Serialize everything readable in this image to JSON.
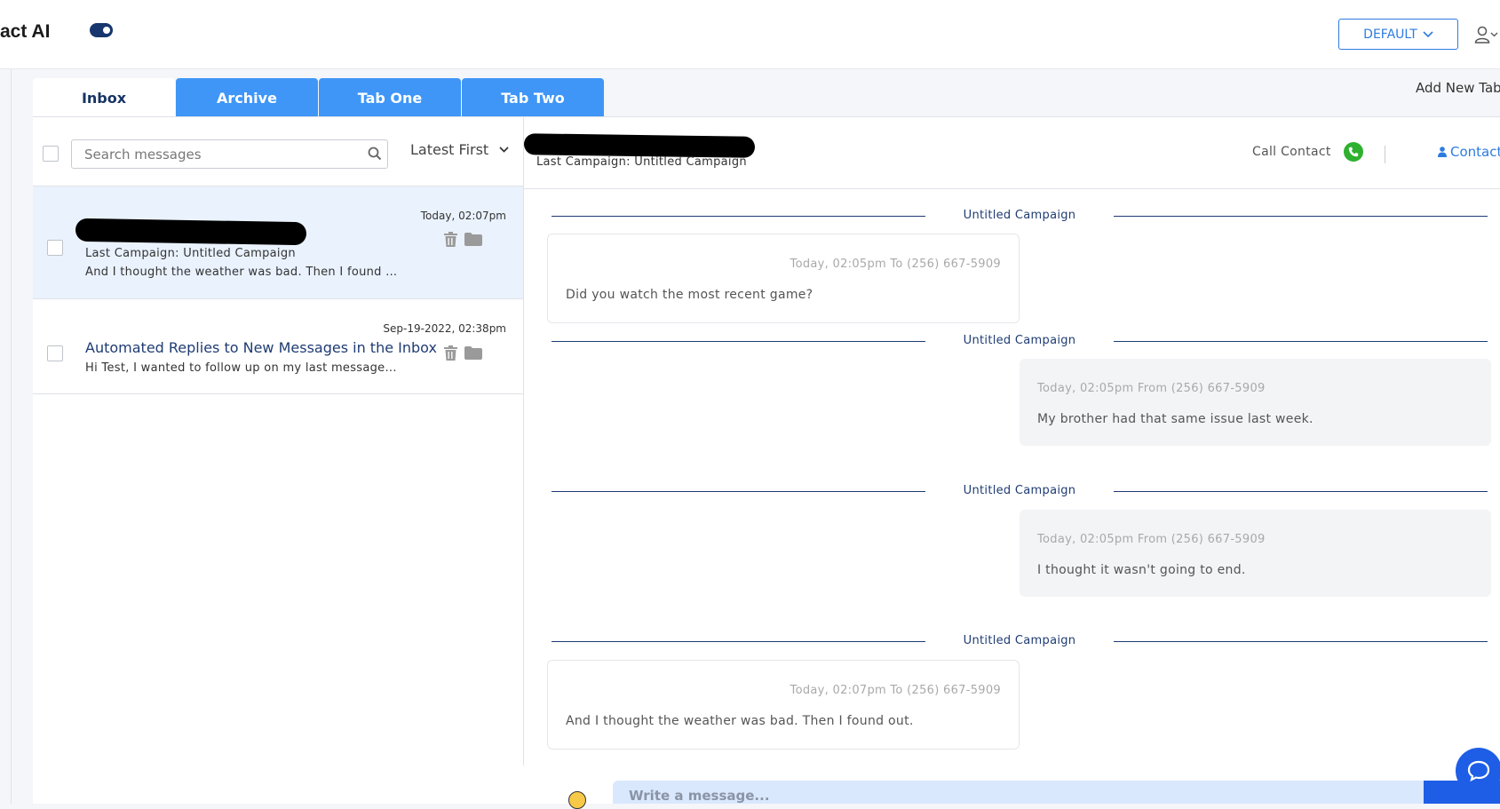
{
  "app": {
    "brand": "act AI"
  },
  "header": {
    "profile_label": "DEFAULT",
    "toggle_on": true
  },
  "tabs": [
    {
      "label": "Inbox",
      "active": true
    },
    {
      "label": "Archive",
      "active": false
    },
    {
      "label": "Tab One",
      "active": false
    },
    {
      "label": "Tab Two",
      "active": false
    }
  ],
  "add_tab_label": "Add New Tab",
  "list": {
    "search_placeholder": "Search messages",
    "sort_label": "Latest First",
    "conversations": [
      {
        "name_redacted": true,
        "time": "Today, 02:07pm",
        "campaign": "Last Campaign: Untitled Campaign",
        "snippet": "And I thought the weather was bad. Then I found out.",
        "selected": true
      },
      {
        "title": "Automated Replies to New Messages in the Inbox",
        "time": "Sep-19-2022, 02:38pm",
        "snippet": "Hi Test, I wanted to follow up on my last message..."
      }
    ]
  },
  "chat": {
    "name_redacted": true,
    "last_campaign": "Last Campaign: Untitled Campaign",
    "call_label": "Call Contact",
    "contact_info_label": "Contact Info",
    "separator_label": "Untitled Campaign",
    "messages": [
      {
        "direction": "out",
        "meta": "Today, 02:05pm To (256) 667-5909",
        "text": "Did you watch the most recent game?"
      },
      {
        "direction": "in",
        "meta": "Today, 02:05pm From (256) 667-5909",
        "text": "My brother had that same issue last week."
      },
      {
        "direction": "in",
        "meta": "Today, 02:05pm From (256) 667-5909",
        "text": "I thought it wasn't going to end."
      },
      {
        "direction": "out",
        "meta": "Today, 02:07pm To (256) 667-5909",
        "text": "And I thought the weather was bad. Then I found out."
      }
    ],
    "compose_placeholder": "Write a message..."
  },
  "colors": {
    "accent_blue": "#3f96f7",
    "navy": "#1f3c73",
    "link_blue": "#2d7be0",
    "call_green": "#2fb12f",
    "selected_row": "#eaf2fe"
  }
}
